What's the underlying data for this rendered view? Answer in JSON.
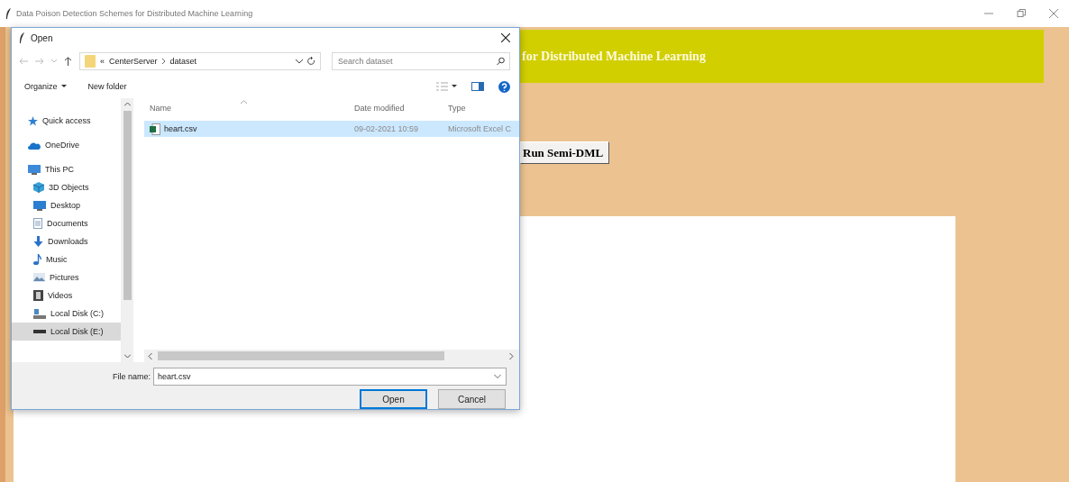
{
  "window": {
    "title": "Data Poison Detection Schemes for Distributed Machine Learning"
  },
  "app": {
    "heading": "for Distributed Machine Learning",
    "button": "Run Semi-DML"
  },
  "dialog": {
    "title": "Open",
    "address": {
      "prefix": "«",
      "path": [
        {
          "label": "CenterServer"
        },
        {
          "label": "dataset"
        }
      ]
    },
    "search": {
      "placeholder": "Search dataset"
    },
    "toolbar": {
      "organize": "Organize",
      "new_folder": "New folder"
    },
    "nav": [
      {
        "label": "Quick access",
        "kind": "star",
        "selected": false
      },
      {
        "label": "OneDrive",
        "kind": "cloud",
        "selected": false
      },
      {
        "label": "This PC",
        "kind": "pc",
        "selected": false,
        "children": [
          {
            "label": "3D Objects",
            "kind": "cube",
            "selected": false
          },
          {
            "label": "Desktop",
            "kind": "desktop",
            "selected": false
          },
          {
            "label": "Documents",
            "kind": "document",
            "selected": false
          },
          {
            "label": "Downloads",
            "kind": "download",
            "selected": false
          },
          {
            "label": "Music",
            "kind": "music",
            "selected": false
          },
          {
            "label": "Pictures",
            "kind": "pictures",
            "selected": false
          },
          {
            "label": "Videos",
            "kind": "videos",
            "selected": false
          },
          {
            "label": "Local Disk (C:)",
            "kind": "disk-c",
            "selected": false
          },
          {
            "label": "Local Disk (E:)",
            "kind": "disk",
            "selected": true
          }
        ]
      }
    ],
    "columns": [
      "Name",
      "Date modified",
      "Type"
    ],
    "files": [
      {
        "name": "heart.csv",
        "date": "09-02-2021 10:59",
        "type": "Microsoft Excel C",
        "selected": true
      }
    ],
    "file_name_label": "File name:",
    "file_name": "heart.csv",
    "buttons": [
      {
        "label": "Open",
        "kind": "primary"
      },
      {
        "label": "Cancel",
        "kind": "normal"
      }
    ]
  }
}
